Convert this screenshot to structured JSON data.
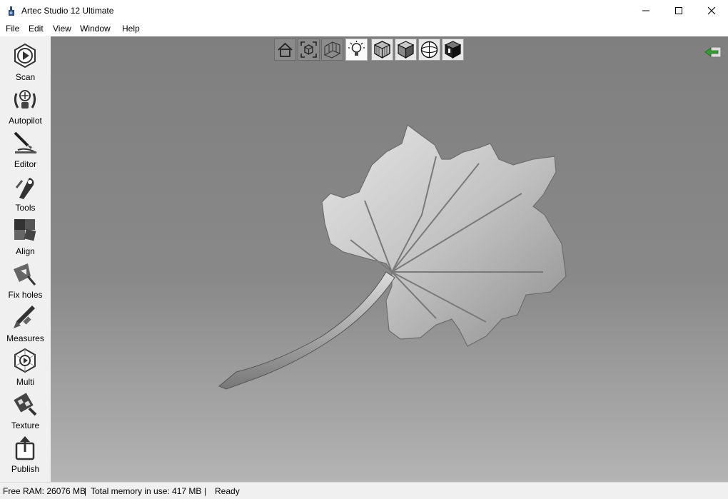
{
  "window": {
    "title": "Artec Studio 12 Ultimate",
    "controls": [
      "minimize-icon",
      "maximize-icon",
      "close-icon"
    ]
  },
  "menu": [
    "File",
    "Edit",
    "View",
    "Window",
    "Help"
  ],
  "sidebar": {
    "items": [
      {
        "label": "Scan",
        "icon": "scan-icon"
      },
      {
        "label": "Autopilot",
        "icon": "autopilot-icon"
      },
      {
        "label": "Editor",
        "icon": "editor-icon"
      },
      {
        "label": "Tools",
        "icon": "tools-icon"
      },
      {
        "label": "Align",
        "icon": "align-icon"
      },
      {
        "label": "Fix holes",
        "icon": "fix-holes-icon"
      },
      {
        "label": "Measures",
        "icon": "measures-icon"
      },
      {
        "label": "Multi",
        "icon": "multi-icon"
      },
      {
        "label": "Texture",
        "icon": "texture-icon"
      },
      {
        "label": "Publish",
        "icon": "publish-icon"
      }
    ]
  },
  "viewport_toolbar": [
    {
      "icon": "home-view-icon"
    },
    {
      "icon": "fit-to-view-icon"
    },
    {
      "icon": "grid-icon"
    },
    {
      "icon": "light-icon"
    },
    {
      "icon": "wireframe-render-icon"
    },
    {
      "icon": "solid-render-icon"
    },
    {
      "icon": "perspective-icon"
    },
    {
      "icon": "texture-render-icon"
    }
  ],
  "viewport": {
    "return_icon": "back-arrow-icon",
    "model": "leaf-3d-scan"
  },
  "status": {
    "free_ram": "Free RAM: 26076 MB",
    "total_memory": "Total memory in use: 417 MB",
    "state": "Ready",
    "sep": "|"
  }
}
